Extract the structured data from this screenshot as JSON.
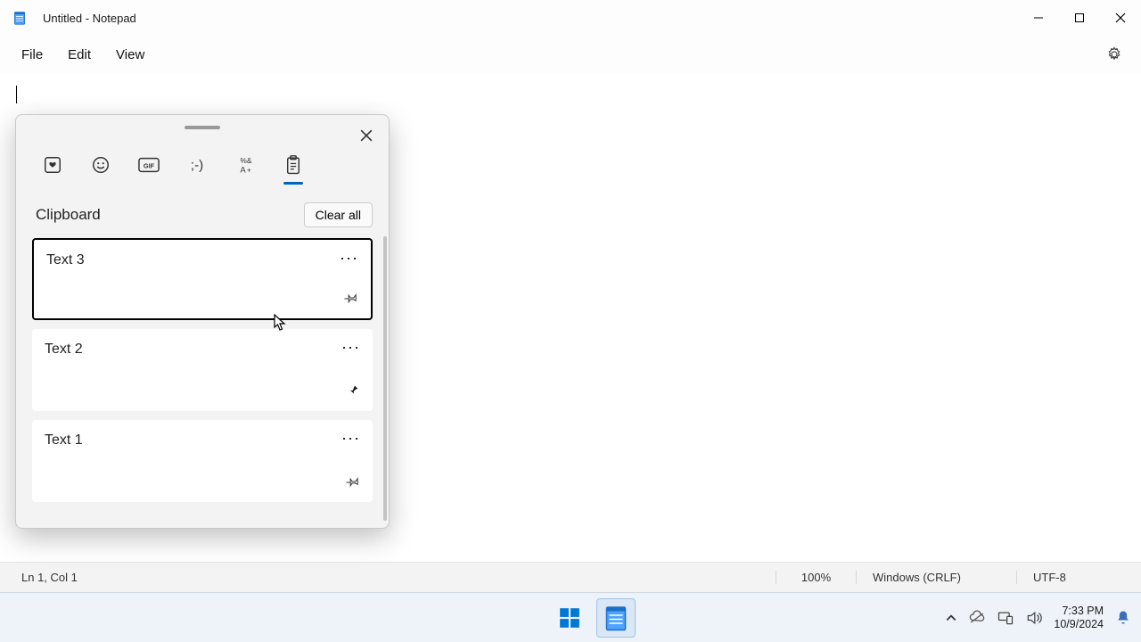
{
  "window": {
    "title": "Untitled - Notepad"
  },
  "menu": {
    "file": "File",
    "edit": "Edit",
    "view": "View"
  },
  "status": {
    "position": "Ln 1, Col 1",
    "zoom": "100%",
    "eol": "Windows (CRLF)",
    "encoding": "UTF-8"
  },
  "clipboard_panel": {
    "title": "Clipboard",
    "clear_all": "Clear all",
    "items": [
      {
        "text": "Text 3",
        "pinned": false,
        "selected": true
      },
      {
        "text": "Text 2",
        "pinned": true,
        "selected": false
      },
      {
        "text": "Text 1",
        "pinned": false,
        "selected": false
      }
    ]
  },
  "tray": {
    "time": "7:33 PM",
    "date": "10/9/2024"
  }
}
